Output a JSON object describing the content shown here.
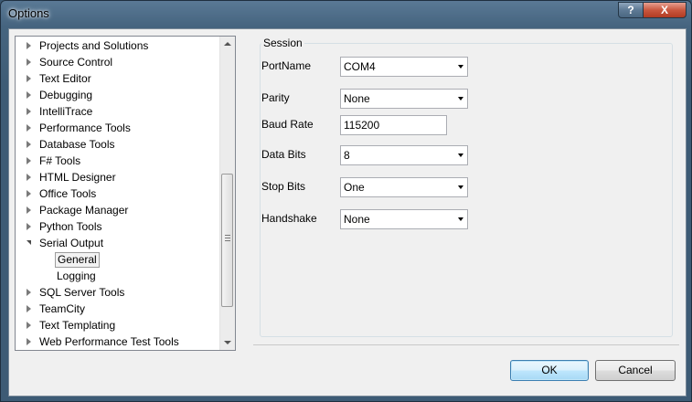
{
  "window": {
    "title": "Options",
    "help_label": "?",
    "close_label": "X"
  },
  "tree": {
    "items": [
      {
        "label": "Projects and Solutions",
        "level": 0,
        "expanded": false
      },
      {
        "label": "Source Control",
        "level": 0,
        "expanded": false
      },
      {
        "label": "Text Editor",
        "level": 0,
        "expanded": false
      },
      {
        "label": "Debugging",
        "level": 0,
        "expanded": false
      },
      {
        "label": "IntelliTrace",
        "level": 0,
        "expanded": false
      },
      {
        "label": "Performance Tools",
        "level": 0,
        "expanded": false
      },
      {
        "label": "Database Tools",
        "level": 0,
        "expanded": false
      },
      {
        "label": "F# Tools",
        "level": 0,
        "expanded": false
      },
      {
        "label": "HTML Designer",
        "level": 0,
        "expanded": false
      },
      {
        "label": "Office Tools",
        "level": 0,
        "expanded": false
      },
      {
        "label": "Package Manager",
        "level": 0,
        "expanded": false
      },
      {
        "label": "Python Tools",
        "level": 0,
        "expanded": false
      },
      {
        "label": "Serial Output",
        "level": 0,
        "expanded": true
      },
      {
        "label": "General",
        "level": 1,
        "selected": true
      },
      {
        "label": "Logging",
        "level": 1
      },
      {
        "label": "SQL Server Tools",
        "level": 0,
        "expanded": false
      },
      {
        "label": "TeamCity",
        "level": 0,
        "expanded": false
      },
      {
        "label": "Text Templating",
        "level": 0,
        "expanded": false
      },
      {
        "label": "Web Performance Test Tools",
        "level": 0,
        "expanded": false
      }
    ]
  },
  "session": {
    "title": "Session",
    "fields": [
      {
        "label": "PortName",
        "value": "COM4",
        "kind": "combo"
      },
      {
        "label": "Parity",
        "value": "None",
        "kind": "combo"
      },
      {
        "label": "Baud Rate",
        "value": "115200",
        "kind": "text"
      },
      {
        "label": "Data Bits",
        "value": "8",
        "kind": "combo"
      },
      {
        "label": "Stop Bits",
        "value": "One",
        "kind": "combo"
      },
      {
        "label": "Handshake",
        "value": "None",
        "kind": "combo"
      }
    ]
  },
  "buttons": {
    "ok": "OK",
    "cancel": "Cancel"
  }
}
